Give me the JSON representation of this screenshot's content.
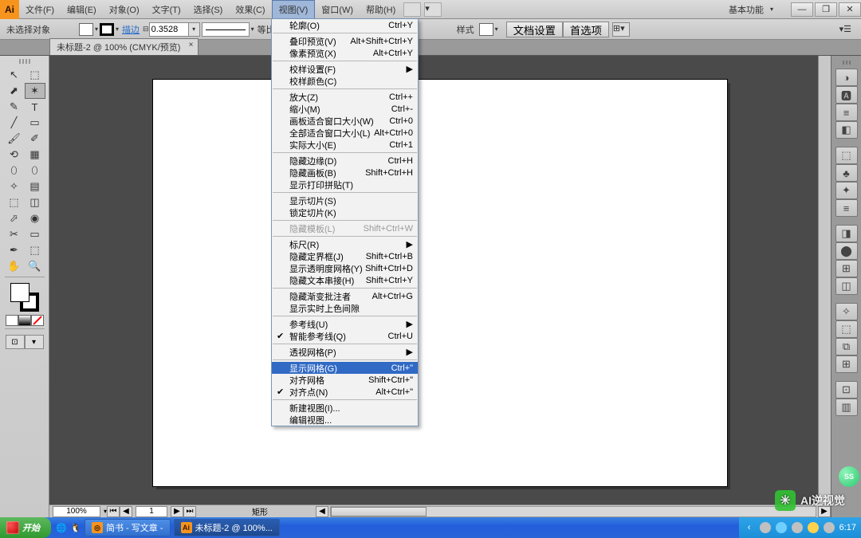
{
  "app_icon": "Ai",
  "menubar": [
    "文件(F)",
    "编辑(E)",
    "对象(O)",
    "文字(T)",
    "选择(S)",
    "效果(C)",
    "视图(V)",
    "窗口(W)",
    "帮助(H)"
  ],
  "menubar_open_index": 6,
  "workspace_label": "基本功能",
  "win_buttons": [
    "—",
    "❐",
    "✕"
  ],
  "optionsbar": {
    "no_selection": "未选择对象",
    "stroke_link": "描边",
    "stroke_val": "0.3528",
    "uniform": "等比",
    "style": "样式",
    "doc_setup": "文档设置",
    "prefs": "首选项"
  },
  "doc_tab": "未标题-2 @ 100% (CMYK/预览)",
  "doc_tab_x": "×",
  "dropdown": [
    {
      "t": "item",
      "label": "轮廓(O)",
      "sc": "Ctrl+Y"
    },
    {
      "t": "sep"
    },
    {
      "t": "item",
      "label": "叠印预览(V)",
      "sc": "Alt+Shift+Ctrl+Y"
    },
    {
      "t": "item",
      "label": "像素预览(X)",
      "sc": "Alt+Ctrl+Y"
    },
    {
      "t": "sep"
    },
    {
      "t": "item",
      "label": "校样设置(F)",
      "arr": true
    },
    {
      "t": "item",
      "label": "校样颜色(C)"
    },
    {
      "t": "sep"
    },
    {
      "t": "item",
      "label": "放大(Z)",
      "sc": "Ctrl++"
    },
    {
      "t": "item",
      "label": "缩小(M)",
      "sc": "Ctrl+-"
    },
    {
      "t": "item",
      "label": "画板适合窗口大小(W)",
      "sc": "Ctrl+0"
    },
    {
      "t": "item",
      "label": "全部适合窗口大小(L)",
      "sc": "Alt+Ctrl+0"
    },
    {
      "t": "item",
      "label": "实际大小(E)",
      "sc": "Ctrl+1"
    },
    {
      "t": "sep"
    },
    {
      "t": "item",
      "label": "隐藏边缘(D)",
      "sc": "Ctrl+H"
    },
    {
      "t": "item",
      "label": "隐藏画板(B)",
      "sc": "Shift+Ctrl+H"
    },
    {
      "t": "item",
      "label": "显示打印拼贴(T)"
    },
    {
      "t": "sep"
    },
    {
      "t": "item",
      "label": "显示切片(S)"
    },
    {
      "t": "item",
      "label": "锁定切片(K)"
    },
    {
      "t": "sep"
    },
    {
      "t": "item",
      "label": "隐藏模板(L)",
      "sc": "Shift+Ctrl+W",
      "disabled": true
    },
    {
      "t": "sep"
    },
    {
      "t": "item",
      "label": "标尺(R)",
      "arr": true
    },
    {
      "t": "item",
      "label": "隐藏定界框(J)",
      "sc": "Shift+Ctrl+B"
    },
    {
      "t": "item",
      "label": "显示透明度网格(Y)",
      "sc": "Shift+Ctrl+D"
    },
    {
      "t": "item",
      "label": "隐藏文本串接(H)",
      "sc": "Shift+Ctrl+Y"
    },
    {
      "t": "sep"
    },
    {
      "t": "item",
      "label": "隐藏渐变批注者",
      "sc": "Alt+Ctrl+G"
    },
    {
      "t": "item",
      "label": "显示实时上色间隙"
    },
    {
      "t": "sep"
    },
    {
      "t": "item",
      "label": "参考线(U)",
      "arr": true
    },
    {
      "t": "item",
      "label": "智能参考线(Q)",
      "sc": "Ctrl+U",
      "chk": true
    },
    {
      "t": "sep"
    },
    {
      "t": "item",
      "label": "透视网格(P)",
      "arr": true
    },
    {
      "t": "sep"
    },
    {
      "t": "item",
      "label": "显示网格(G)",
      "sc": "Ctrl+\"",
      "hl": true
    },
    {
      "t": "item",
      "label": "对齐网格",
      "sc": "Shift+Ctrl+\""
    },
    {
      "t": "item",
      "label": "对齐点(N)",
      "sc": "Alt+Ctrl+\"",
      "chk": true
    },
    {
      "t": "sep"
    },
    {
      "t": "item",
      "label": "新建视图(I)..."
    },
    {
      "t": "item",
      "label": "编辑视图..."
    }
  ],
  "statusbar": {
    "zoom": "100%",
    "page": "1",
    "tool": "矩形"
  },
  "right_icons": [
    "◑",
    "🅰",
    "≡",
    "◧",
    "⬚",
    "♣",
    "✦",
    "≡",
    "◨",
    "⬤",
    "⊞",
    "◫",
    "✧",
    "⬚",
    "⧉",
    "⊞",
    "⊡",
    "▥"
  ],
  "tool_rows": [
    [
      "↖",
      "⬚"
    ],
    [
      "⬈",
      "✶"
    ],
    [
      "✎",
      "T"
    ],
    [
      "╱",
      "▭"
    ],
    [
      "🖌",
      "✐"
    ],
    [
      "⟲",
      "▦"
    ],
    [
      "⬯",
      "⬯"
    ],
    [
      "✧",
      "▤"
    ],
    [
      "⬚",
      "◫"
    ],
    [
      "⬀",
      "◉"
    ],
    [
      "✂",
      "▭"
    ],
    [
      "✒",
      "⬚"
    ],
    [
      "✋",
      "🔍"
    ]
  ],
  "tool_selected": [
    1,
    1
  ],
  "taskbar": {
    "start": "开始",
    "items": [
      {
        "label": "简书 - 写文章 -",
        "ico": "◎"
      },
      {
        "label": "未标题-2 @ 100%...",
        "ico": "Ai",
        "active": true
      }
    ],
    "clock": "6:17"
  },
  "watermark": "AI逆视觉",
  "green_badge": "SS"
}
